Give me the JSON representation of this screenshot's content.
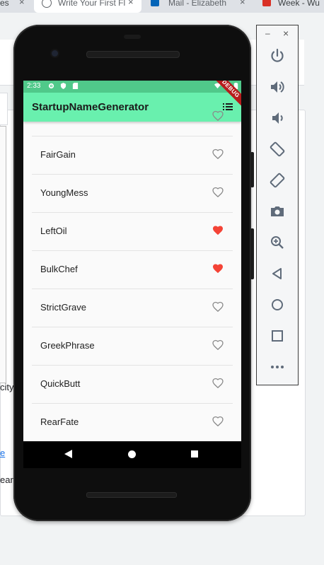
{
  "browser": {
    "tabs": [
      {
        "title": "es"
      },
      {
        "title": "Write Your First Fl"
      },
      {
        "title": "Mail - Elizabeth"
      },
      {
        "title": "Week - Wu"
      }
    ],
    "close_glyph": "×"
  },
  "background_page": {
    "fragments": [
      "city",
      "e",
      "ear"
    ]
  },
  "device": {
    "status_bar": {
      "time": "2:33"
    },
    "app": {
      "title": "StartupNameGenerator",
      "debug_banner": "DEBUG",
      "action_icon": "list-icon"
    },
    "list": [
      {
        "name": "FairGain",
        "saved": false
      },
      {
        "name": "YoungMess",
        "saved": false
      },
      {
        "name": "LeftOil",
        "saved": true
      },
      {
        "name": "BulkChef",
        "saved": true
      },
      {
        "name": "StrictGrave",
        "saved": false
      },
      {
        "name": "GreekPhrase",
        "saved": false
      },
      {
        "name": "QuickButt",
        "saved": false
      },
      {
        "name": "RearFate",
        "saved": false
      }
    ],
    "nav": [
      "back",
      "home",
      "recents"
    ]
  },
  "emulator_toolbar": {
    "minimize_glyph": "–",
    "close_glyph": "×",
    "buttons": [
      "power",
      "volume-up",
      "volume-down",
      "rotate-left",
      "rotate-right",
      "screenshot",
      "zoom",
      "back",
      "home",
      "overview",
      "more"
    ]
  },
  "colors": {
    "status_bar": "#50c98a",
    "app_bar": "#69f0ae",
    "heart_saved": "#f44336",
    "heart_outline": "#8a8a8a"
  }
}
